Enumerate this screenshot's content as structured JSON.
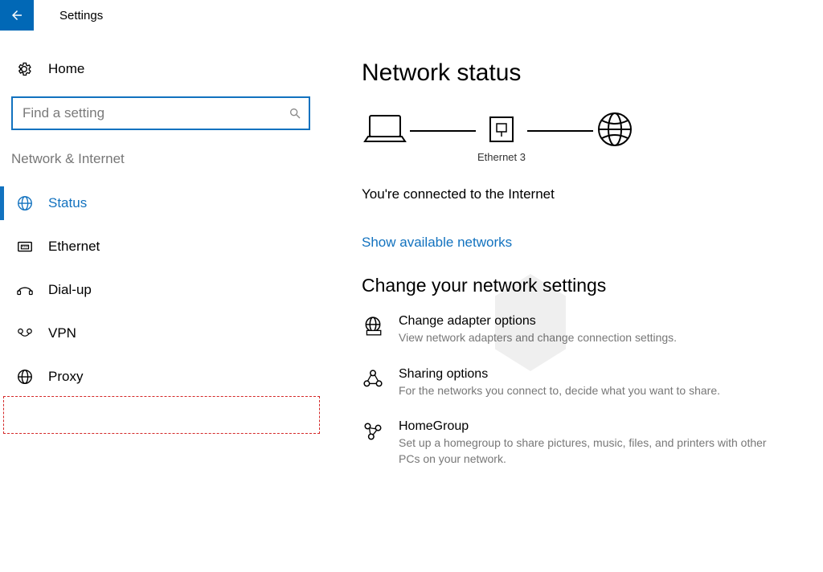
{
  "header": {
    "title": "Settings"
  },
  "sidebar": {
    "home_label": "Home",
    "search_placeholder": "Find a setting",
    "category": "Network & Internet",
    "items": [
      {
        "label": "Status",
        "icon": "status-icon",
        "active": true
      },
      {
        "label": "Ethernet",
        "icon": "ethernet-icon",
        "active": false
      },
      {
        "label": "Dial-up",
        "icon": "dialup-icon",
        "active": false
      },
      {
        "label": "VPN",
        "icon": "vpn-icon",
        "active": false
      },
      {
        "label": "Proxy",
        "icon": "globe-icon",
        "active": false
      }
    ]
  },
  "main": {
    "heading": "Network status",
    "diagram_caption": "Ethernet 3",
    "connected_text": "You're connected to the Internet",
    "show_networks_link": "Show available networks",
    "change_heading": "Change your network settings",
    "settings": [
      {
        "title": "Change adapter options",
        "desc": "View network adapters and change connection settings."
      },
      {
        "title": "Sharing options",
        "desc": "For the networks you connect to, decide what you want to share."
      },
      {
        "title": "HomeGroup",
        "desc": "Set up a homegroup to share pictures, music, files, and printers with other PCs on your network."
      }
    ]
  },
  "highlight": {
    "item_index": 4
  }
}
